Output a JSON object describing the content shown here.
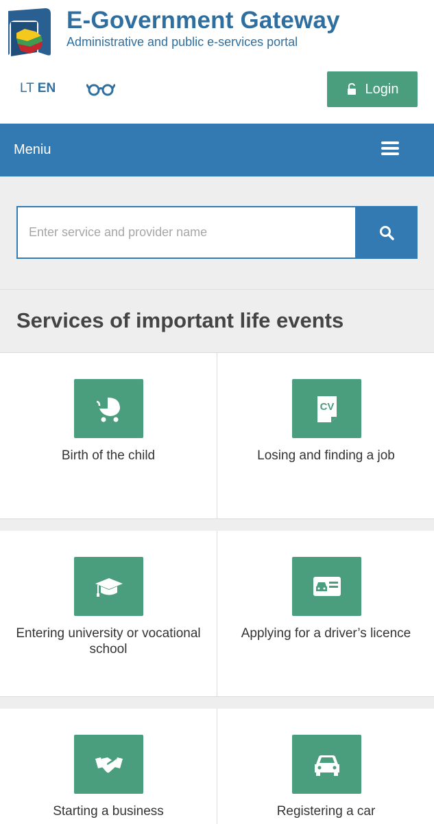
{
  "header": {
    "title": "E-Government Gateway",
    "subtitle": "Administrative and public e-services portal",
    "logo_icon": "lithuania-coat-logo"
  },
  "language": {
    "lt": "LT",
    "en": "EN",
    "active": "EN"
  },
  "accessibility": {
    "icon": "glasses-icon"
  },
  "login": {
    "label": "Login",
    "icon": "lock-icon"
  },
  "menu": {
    "label": "Meniu",
    "icon": "hamburger-icon"
  },
  "search": {
    "placeholder": "Enter service and provider name",
    "value": "",
    "icon": "search-icon"
  },
  "section": {
    "title": "Services of important life events"
  },
  "life_events": [
    {
      "label": "Birth of the child",
      "icon": "baby-carriage-icon"
    },
    {
      "label": "Losing and finding a job",
      "icon": "cv-document-icon"
    },
    {
      "label": "Entering university or vocational school",
      "icon": "graduation-cap-icon"
    },
    {
      "label": "Applying for a driver’s licence",
      "icon": "drivers-licence-icon"
    },
    {
      "label": "Starting a business",
      "icon": "handshake-icon"
    },
    {
      "label": "Registering a car",
      "icon": "car-icon"
    }
  ],
  "colors": {
    "primary_blue": "#337ab2",
    "accent_green": "#4a9e7e",
    "text_blue": "#2f6f9f",
    "background_gray": "#eeeeee"
  }
}
